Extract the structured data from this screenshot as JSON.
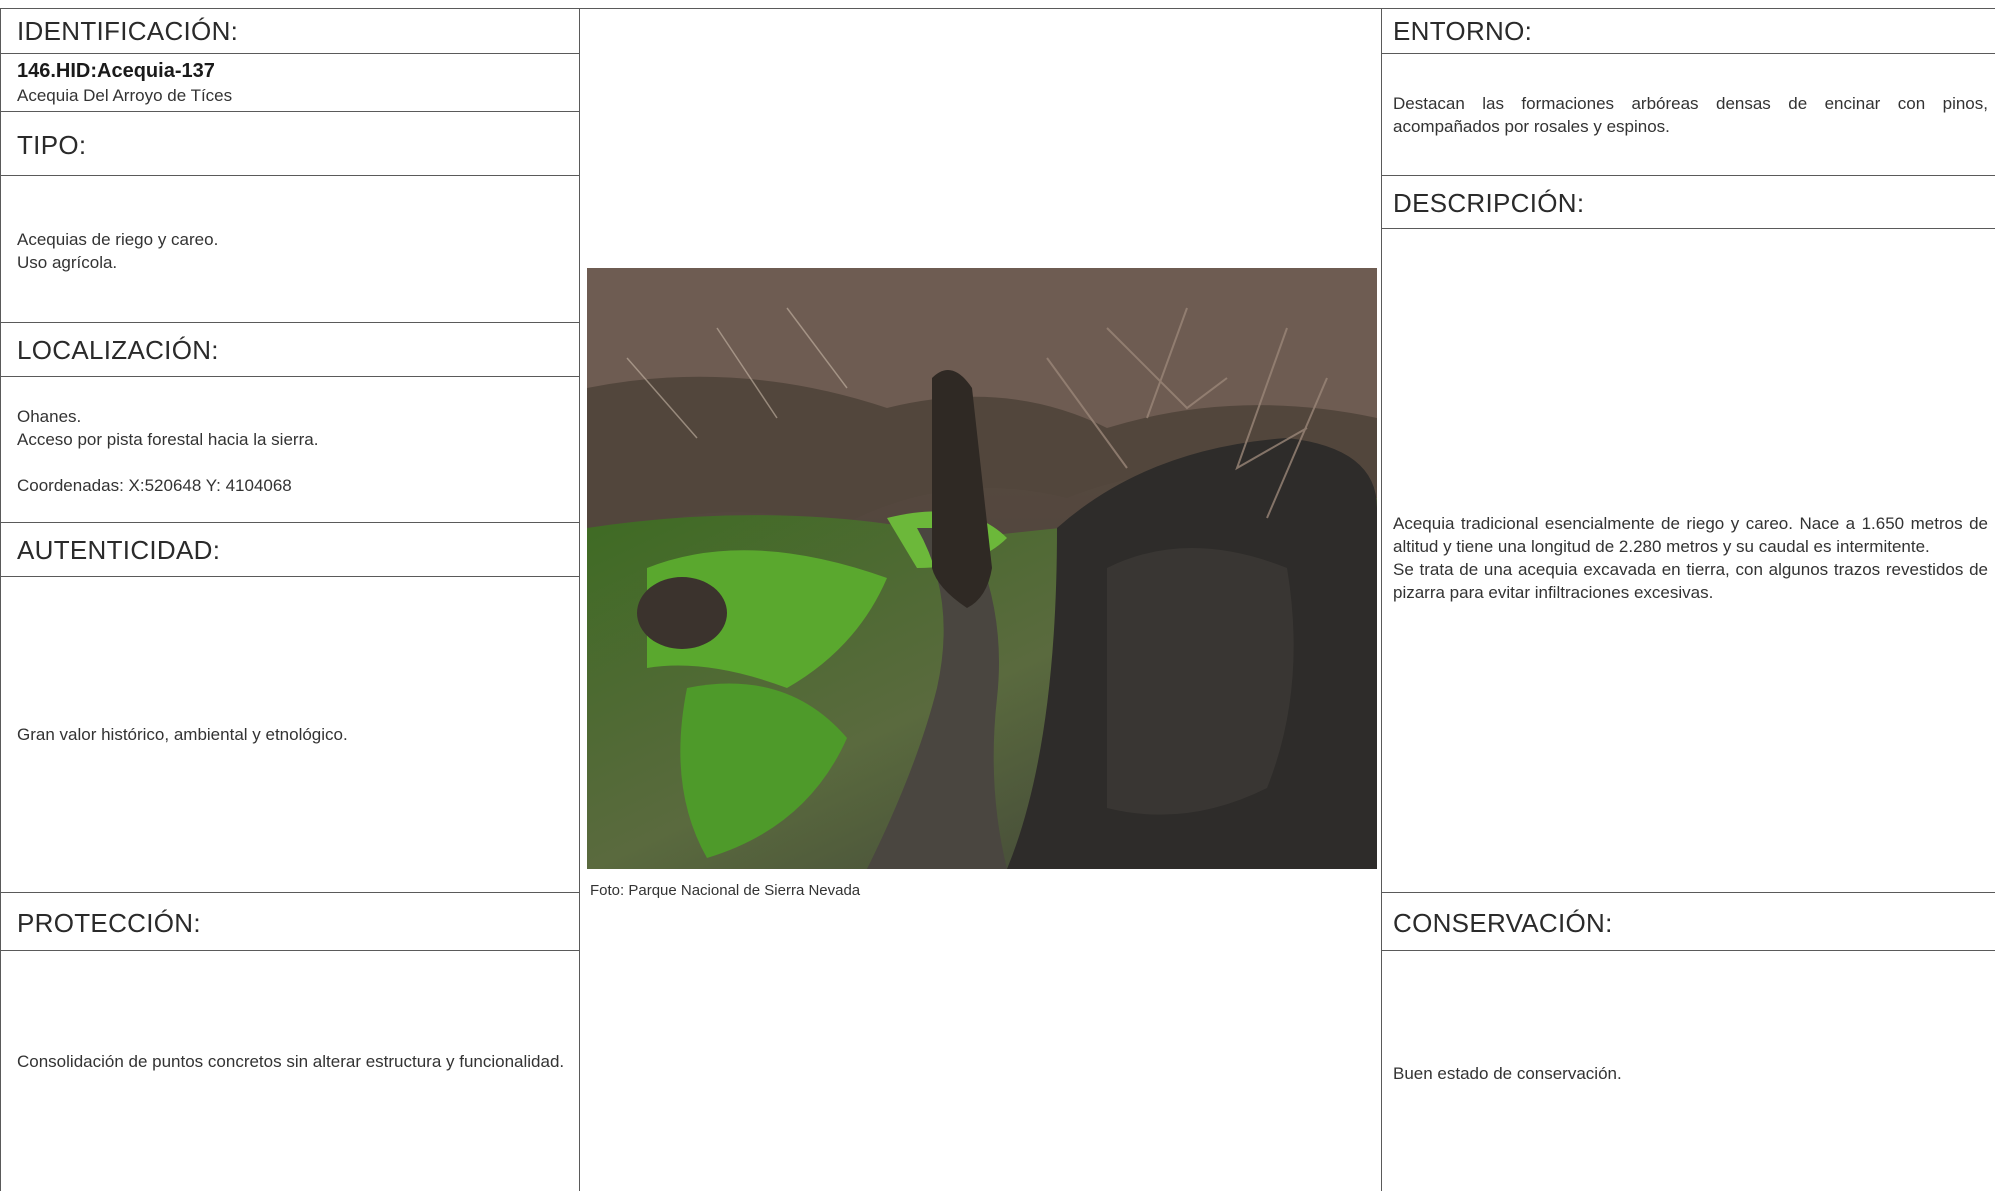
{
  "left": {
    "identificacion": {
      "heading": "IDENTIFICACIÓN:",
      "code": "146.HID:Acequia-137",
      "name": "Acequia Del Arroyo de Tíces"
    },
    "tipo": {
      "heading": "TIPO:",
      "lines": [
        "Acequias de riego y careo.",
        "Uso agrícola."
      ]
    },
    "localizacion": {
      "heading": "LOCALIZACIÓN:",
      "line1": "Ohanes.",
      "line2": "Acceso por pista forestal hacia la sierra.",
      "coords": "Coordenadas: X:520648 Y: 4104068"
    },
    "autenticidad": {
      "heading": "AUTENTICIDAD:",
      "text": "Gran valor histórico, ambiental y etnológico."
    },
    "proteccion": {
      "heading": "PROTECCIÓN:",
      "text": "Consolidación de puntos concretos sin alterar estructura y funcionalidad."
    }
  },
  "center": {
    "caption": "Foto: Parque Nacional de Sierra Nevada"
  },
  "right": {
    "entorno": {
      "heading": "ENTORNO:",
      "text": "Destacan las formaciones arbóreas densas de encinar con pinos, acompañados por rosales y espinos."
    },
    "descripcion": {
      "heading": "DESCRIPCIÓN:",
      "para1": "Acequia tradicional esencialmente de riego y careo. Nace a 1.650 metros de altitud y tiene una longitud de 2.280 metros y su caudal es intermitente.",
      "para2": "Se trata de una acequia excavada en tierra, con algunos trazos revestidos de pizarra para evitar infiltraciones excesivas."
    },
    "conservacion": {
      "heading": "CONSERVACIÓN:",
      "text": "Buen estado de conservación."
    }
  }
}
